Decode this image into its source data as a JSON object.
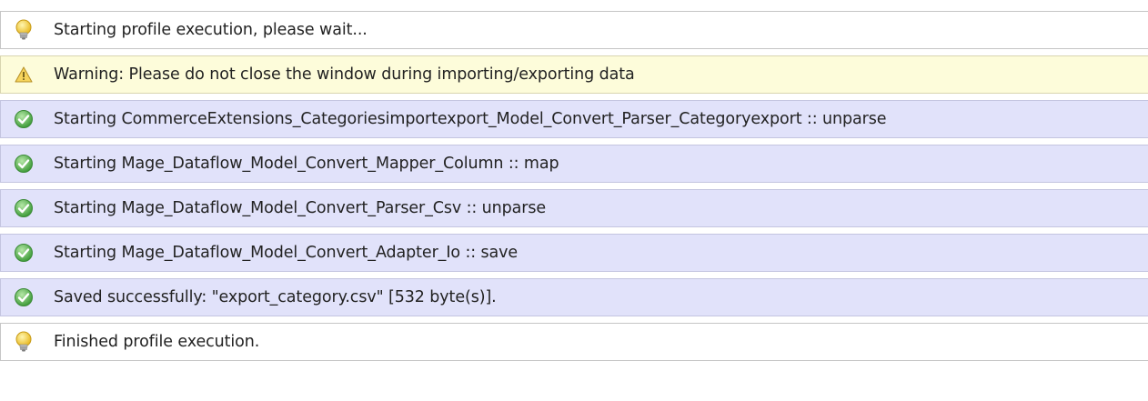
{
  "messages": [
    {
      "type": "info",
      "icon": "lightbulb-icon",
      "text": "Starting profile execution, please wait..."
    },
    {
      "type": "warning",
      "icon": "warning-icon",
      "text": "Warning: Please do not close the window during importing/exporting data"
    },
    {
      "type": "success",
      "icon": "success-icon",
      "text": "Starting CommerceExtensions_Categoriesimportexport_Model_Convert_Parser_Categoryexport :: unparse"
    },
    {
      "type": "success",
      "icon": "success-icon",
      "text": "Starting Mage_Dataflow_Model_Convert_Mapper_Column :: map"
    },
    {
      "type": "success",
      "icon": "success-icon",
      "text": "Starting Mage_Dataflow_Model_Convert_Parser_Csv :: unparse"
    },
    {
      "type": "success",
      "icon": "success-icon",
      "text": "Starting Mage_Dataflow_Model_Convert_Adapter_Io :: save"
    },
    {
      "type": "success",
      "icon": "success-icon",
      "text": "Saved successfully: \"export_category.csv\" [532 byte(s)]."
    },
    {
      "type": "info",
      "icon": "lightbulb-icon",
      "text": "Finished profile execution."
    }
  ],
  "colors": {
    "info_bg": "#ffffff",
    "warning_bg": "#fdfcda",
    "success_bg": "#e1e2fa",
    "success_icon": "#5fb85a",
    "warning_icon": "#e8c04a",
    "info_icon": "#f3d250"
  }
}
